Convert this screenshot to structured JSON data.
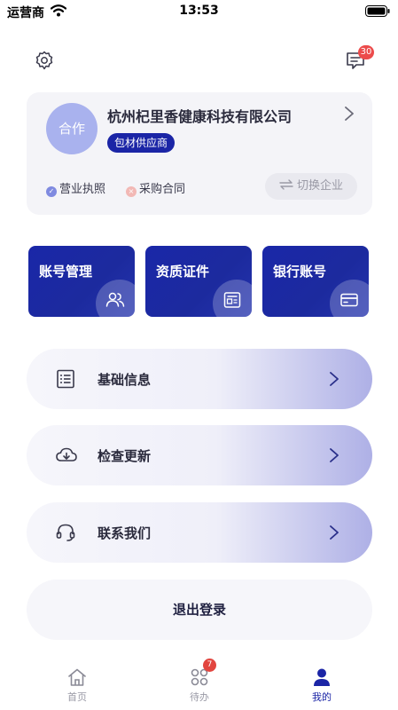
{
  "status_bar": {
    "carrier": "运营商",
    "time": "13:53"
  },
  "header": {
    "settings_icon": "gear-icon",
    "messages_icon": "message-icon",
    "messages_badge": "30"
  },
  "company": {
    "avatar_text": "合作",
    "name": "杭州杞里香健康科技有限公司",
    "role": "包材供应商",
    "certs": [
      {
        "label": "营业执照",
        "status": "verified",
        "color": "#7f8ae0"
      },
      {
        "label": "采购合同",
        "status": "missing",
        "color": "#f2b8b5"
      }
    ],
    "switch_label": "切换企业",
    "switch_icon": "swap-arrows-icon"
  },
  "quick_tiles": [
    {
      "label": "账号管理",
      "icon": "users-icon"
    },
    {
      "label": "资质证件",
      "icon": "document-icon"
    },
    {
      "label": "银行账号",
      "icon": "bank-card-icon"
    }
  ],
  "menu": [
    {
      "label": "基础信息",
      "icon": "list-icon"
    },
    {
      "label": "检查更新",
      "icon": "cloud-download-icon"
    },
    {
      "label": "联系我们",
      "icon": "headset-icon"
    }
  ],
  "logout_label": "退出登录",
  "tabbar": {
    "items": [
      {
        "label": "首页",
        "icon": "home-icon",
        "active": false
      },
      {
        "label": "待办",
        "icon": "grid-icon",
        "active": false,
        "badge": "7"
      },
      {
        "label": "我的",
        "icon": "person-icon",
        "active": true
      }
    ]
  },
  "colors": {
    "primary": "#1b25a6",
    "badge_red": "#ec4b4b",
    "card_bg": "#f4f4f8"
  }
}
